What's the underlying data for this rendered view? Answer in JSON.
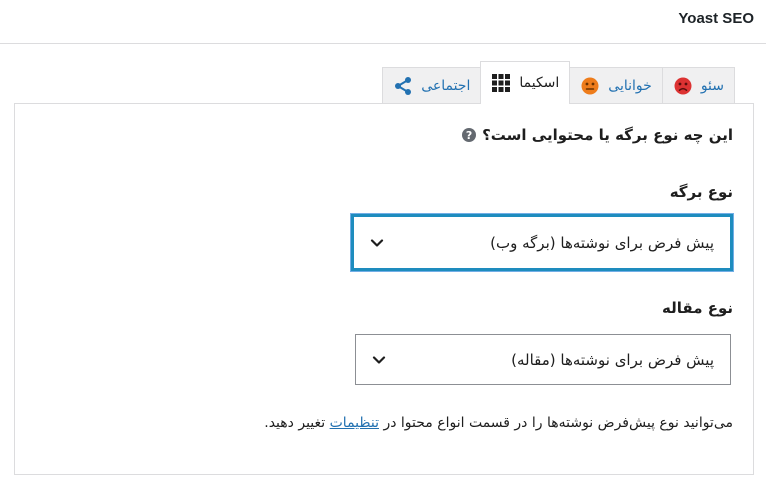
{
  "panel": {
    "title": "Yoast SEO"
  },
  "tabs": [
    {
      "label": "سئو",
      "icon": "sad-face-icon",
      "active": false
    },
    {
      "label": "خوانایی",
      "icon": "neutral-face-icon",
      "active": false
    },
    {
      "label": "اسکیما",
      "icon": "grid-icon",
      "active": true
    },
    {
      "label": "اجتماعی",
      "icon": "share-icon",
      "active": false
    }
  ],
  "content": {
    "question": "این چه نوع برگه یا محتوایی است؟",
    "help_icon": "?",
    "page_type": {
      "label": "نوع برگه",
      "selected": "پیش فرض برای نوشته‌ها (برگه وب)"
    },
    "article_type": {
      "label": "نوع مقاله",
      "selected": "پیش فرض برای نوشته‌ها (مقاله)"
    },
    "note": {
      "before": "می‌توانید نوع پیش‌فرض نوشته‌ها را در قسمت انواع محتوا در ",
      "link": "تنظیمات",
      "after": " تغییر دهید."
    }
  },
  "colors": {
    "tab_link": "#2271b1",
    "focus_border": "#1e8cbe",
    "sad_face": "#dc3232",
    "neutral_face": "#ee7c1b",
    "border": "#dcdcde"
  }
}
